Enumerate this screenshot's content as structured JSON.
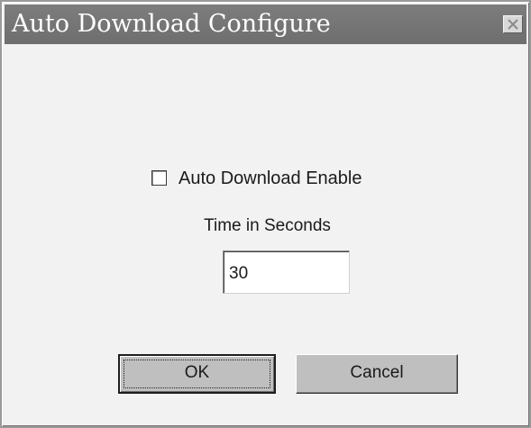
{
  "window": {
    "title": "Auto Download Configure"
  },
  "icons": {
    "close": "close-icon"
  },
  "form": {
    "auto_download_label": "Auto Download Enable",
    "auto_download_checked": false,
    "time_label": "Time in Seconds",
    "time_value": "30"
  },
  "buttons": {
    "ok_label": "OK",
    "cancel_label": "Cancel"
  }
}
